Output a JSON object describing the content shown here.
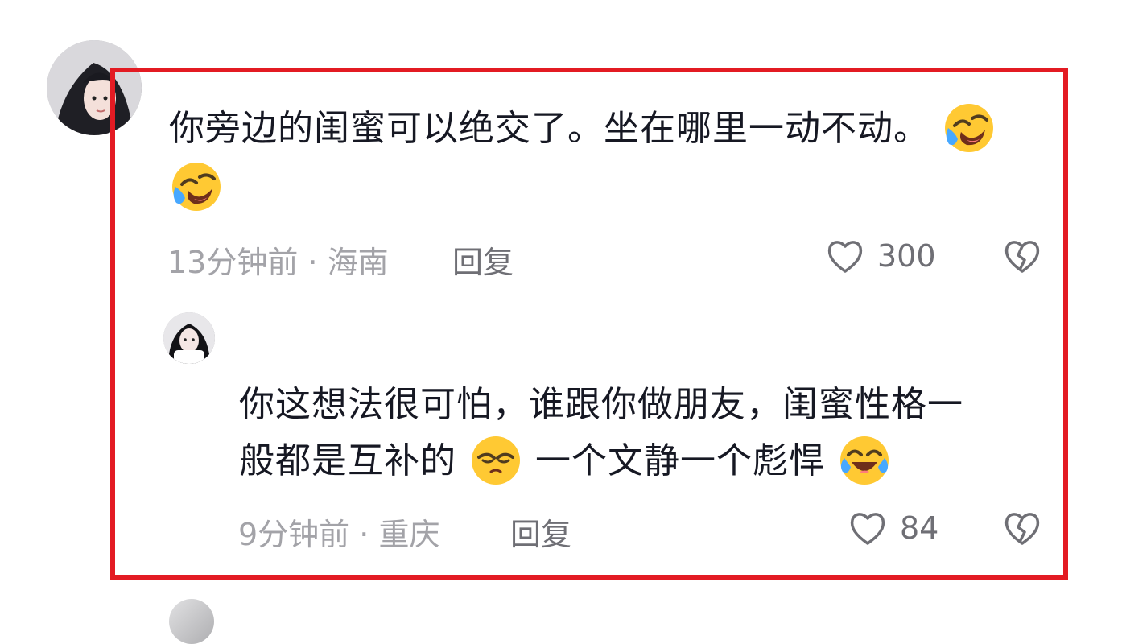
{
  "comment": {
    "line1": "你旁边的闺蜜可以绝交了。坐在哪里一动不动。",
    "time": "13分钟前",
    "separator": "·",
    "location": "海南",
    "reply_label": "回复",
    "likes": "300",
    "emoji": "laugh-cry-emoji"
  },
  "reply": {
    "line1": "你这想法很可怕，谁跟你做朋友，闺蜜性格一",
    "line2_part1": "般都是互补的",
    "line2_part2": "一个文静一个彪悍",
    "time": "9分钟前",
    "separator": "·",
    "location": "重庆",
    "reply_label": "回复",
    "likes": "84",
    "emojis": [
      "smug-emoji",
      "laugh-tears-emoji"
    ]
  },
  "icons": {
    "like": "heart-outline-icon",
    "dislike": "broken-heart-icon"
  },
  "colors": {
    "frame": "#e31b23",
    "text": "#161823",
    "meta": "#a3a3a8",
    "action": "#6f6f75",
    "emoji_yellow": "#ffc933"
  }
}
